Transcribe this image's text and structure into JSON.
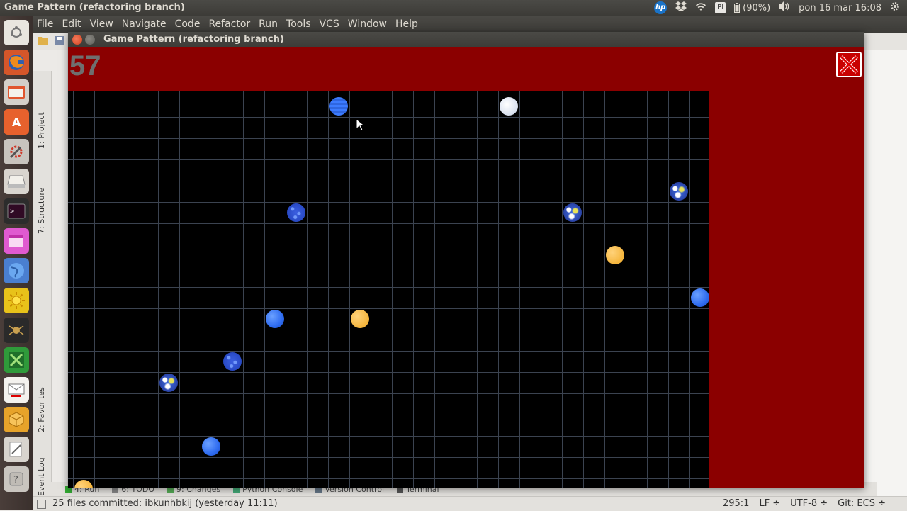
{
  "os": {
    "window_title": "Game Pattern (refactoring branch)",
    "tray": {
      "hp": "hp",
      "keyboard": "Pl",
      "battery": "(90%)",
      "clock": "pon 16 mar 16:08"
    }
  },
  "ide": {
    "menu": [
      "File",
      "Edit",
      "View",
      "Navigate",
      "Code",
      "Refactor",
      "Run",
      "Tools",
      "VCS",
      "Window",
      "Help"
    ],
    "side_tabs": {
      "project": "1: Project",
      "structure": "7: Structure",
      "favorites": "2: Favorites",
      "run_panel": "Run"
    },
    "bottom_tabs": [
      "4: Run",
      "6: TODO",
      "9: Changes",
      "Python Console",
      "Version Control",
      "Terminal"
    ],
    "status": {
      "message": "25 files committed: ibkunhbkij (yesterday 11:11)",
      "position": "295:1",
      "line_ending": "LF ÷",
      "encoding": "UTF-8 ÷",
      "vcs": "Git: ECS ÷"
    },
    "event_log": "Event Log"
  },
  "game": {
    "title": "Game Pattern (refactoring branch)",
    "score": "57",
    "balls": [
      {
        "type": "striped",
        "col": 12,
        "row": 0
      },
      {
        "type": "white",
        "col": 20,
        "row": 0
      },
      {
        "type": "earth",
        "col": 28,
        "row": 4
      },
      {
        "type": "bluepattern",
        "col": 10,
        "row": 5
      },
      {
        "type": "earth",
        "col": 23,
        "row": 5
      },
      {
        "type": "yellow",
        "col": 25,
        "row": 7
      },
      {
        "type": "blue",
        "col": 29,
        "row": 9
      },
      {
        "type": "blue",
        "col": 9,
        "row": 10
      },
      {
        "type": "yellow",
        "col": 13,
        "row": 10
      },
      {
        "type": "bluepattern",
        "col": 7,
        "row": 12
      },
      {
        "type": "earth",
        "col": 4,
        "row": 13
      },
      {
        "type": "blue",
        "col": 6,
        "row": 16
      },
      {
        "type": "yellow",
        "col": 0,
        "row": 18
      }
    ]
  }
}
